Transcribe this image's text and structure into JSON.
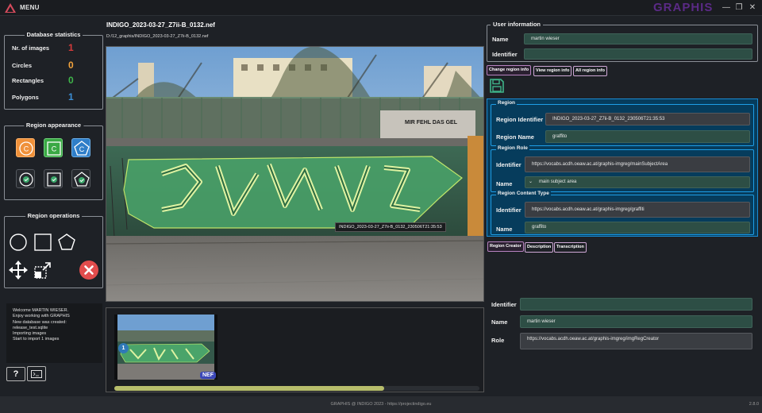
{
  "app": {
    "menu_label": "MENU",
    "brand": "GRAPHIS",
    "minimize_glyph": "—",
    "restore_glyph": "❐",
    "close_glyph": "✕"
  },
  "stats": {
    "title": "Database statistics",
    "rows": [
      {
        "label": "Nr. of  images",
        "value": "1",
        "color": "#d63b3b"
      },
      {
        "label": "Circles",
        "value": "0",
        "color": "#f2a33c"
      },
      {
        "label": "Rectangles",
        "value": "0",
        "color": "#3fb54a"
      },
      {
        "label": "Polygons",
        "value": "1",
        "color": "#3b8fd6"
      }
    ]
  },
  "appearance": {
    "title": "Region appearance",
    "circle_letter": "C",
    "rect_letter": "C",
    "poly_letter": "C"
  },
  "operations": {
    "title": "Region operations"
  },
  "log": {
    "lines": [
      "Welcome MARTIN WIESER.",
      "Enjoy working with GRAPHIS",
      "New database was created:",
      "release_test.sqlite",
      "Importing images",
      "   Start to import 1 images"
    ]
  },
  "bottom_buttons": {
    "help_label": "?"
  },
  "image": {
    "title": "INDIGO_2023-03-27_Z7ii-B_0132.nef",
    "path": "D:/12_graphis/INDIGO_2023-03-27_Z7ii-B_0132.nef",
    "region_tooltip": "INDIGO_2023-03-27_Z7ii-B_0132_230506T21:35:53",
    "wall_sign": "MIR FEHL DAS GEL"
  },
  "thumbnails": {
    "badge": "1",
    "format_badge": "NEF",
    "progress": 0.74
  },
  "user_info": {
    "title": "User information",
    "name_label": "Name",
    "name_value": "martin wieser",
    "identifier_label": "Identifier",
    "identifier_value": ""
  },
  "tabs_top": [
    {
      "label": "Change region info",
      "active": true
    },
    {
      "label": "View region info",
      "active": false
    },
    {
      "label": "All region info",
      "active": false
    }
  ],
  "region": {
    "title": "Region",
    "identifier_label": "Region Identifier",
    "identifier_value": "INDIGO_2023-03-27_Z7ii-B_0132_230506T21:35:53",
    "name_label": "Region Name",
    "name_value": "graffito"
  },
  "region_role": {
    "title": "Region Role",
    "identifier_label": "Identifier",
    "identifier_value": "https://vocabs.acdh.oeaw.ac.at/graphis-imgreg/mainSubjectArea",
    "name_label": "Name",
    "name_value": "main subject area",
    "chevron": "⌄"
  },
  "region_content": {
    "title": "Region Content Type",
    "identifier_label": "Identifier",
    "identifier_value": "https://vocabs.acdh.oeaw.ac.at/graphis-imgreg/graffiti",
    "name_label": "Name",
    "name_value": "graffito"
  },
  "tabs_bottom": [
    {
      "label": "Region Creator",
      "active": true
    },
    {
      "label": "Description",
      "active": false
    },
    {
      "label": "Transcription",
      "active": false
    }
  ],
  "creator": {
    "identifier_label": "Identifier",
    "identifier_value": "",
    "name_label": "Name",
    "name_value": "martin wieser",
    "role_label": "Role",
    "role_value": "https://vocabs.acdh.oeaw.ac.at/graphis-imgreg/imgRegCreator"
  },
  "footer": {
    "text": "GRAPHIS @ INDIGO 2023 - https://projectindigo.eu",
    "right": "2.8.0"
  }
}
